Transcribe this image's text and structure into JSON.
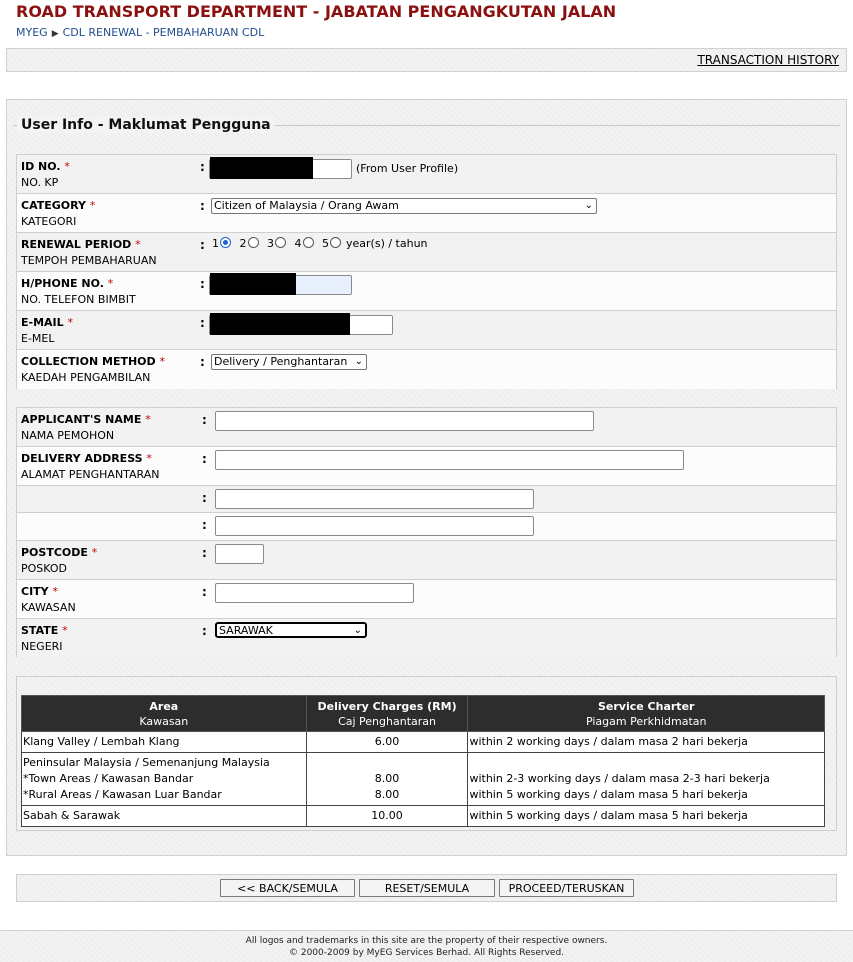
{
  "header": {
    "title": "ROAD TRANSPORT DEPARTMENT - JABATAN PENGANGKUTAN JALAN",
    "breadcrumb": [
      "MYEG",
      "CDL RENEWAL - PEMBAHARUAN CDL"
    ],
    "transaction_history": "TRANSACTION HISTORY"
  },
  "section": {
    "title": "User Info - Maklumat Pengguna"
  },
  "user_info": {
    "id_no": {
      "label": "ID NO.",
      "sub": "NO. KP",
      "required": "*",
      "note": "(From User Profile)"
    },
    "category": {
      "label": "CATEGORY",
      "sub": "KATEGORI",
      "required": "*",
      "selected": "Citizen of Malaysia / Orang Awam"
    },
    "renewal_period": {
      "label": "RENEWAL PERIOD",
      "sub": "TEMPOH PEMBAHARUAN",
      "required": "*",
      "options": [
        "1",
        "2",
        "3",
        "4",
        "5"
      ],
      "selected": "1",
      "suffix": "year(s) / tahun"
    },
    "phone": {
      "label": "H/PHONE NO.",
      "sub": "NO. TELEFON BIMBIT",
      "required": "*"
    },
    "email": {
      "label": "E-MAIL",
      "sub": "E-MEL",
      "required": "*"
    },
    "collection": {
      "label": "COLLECTION METHOD",
      "sub": "KAEDAH PENGAMBILAN",
      "required": "*",
      "selected": "Delivery / Penghantaran"
    }
  },
  "delivery": {
    "name": {
      "label": "APPLICANT'S NAME",
      "sub": "NAMA PEMOHON",
      "required": "*",
      "value": ""
    },
    "address": {
      "label": "DELIVERY ADDRESS",
      "sub": "ALAMAT PENGHANTARAN",
      "required": "*",
      "line1": "",
      "line2": "",
      "line3": ""
    },
    "postcode": {
      "label": "POSTCODE",
      "sub": "POSKOD",
      "required": "*",
      "value": ""
    },
    "city": {
      "label": "CITY",
      "sub": "KAWASAN",
      "required": "*",
      "value": ""
    },
    "state": {
      "label": "STATE",
      "sub": "NEGERI",
      "required": "*",
      "selected": "SARAWAK"
    }
  },
  "charges": {
    "headers": [
      {
        "en": "Area",
        "ms": "Kawasan"
      },
      {
        "en": "Delivery Charges (RM)",
        "ms": "Caj Penghantaran"
      },
      {
        "en": "Service Charter",
        "ms": "Piagam Perkhidmatan"
      }
    ],
    "rows": [
      {
        "area": "Klang Valley / Lembah Klang",
        "charge": "6.00",
        "charter": "within 2 working days / dalam masa 2 hari bekerja"
      },
      {
        "area": "Peninsular Malaysia / Semenanjung Malaysia",
        "charge": "",
        "charter": ""
      },
      {
        "area": "*Town Areas / Kawasan Bandar",
        "charge": "8.00",
        "charter": "within 2-3 working days / dalam masa 2-3 hari bekerja"
      },
      {
        "area": "*Rural Areas / Kawasan Luar Bandar",
        "charge": "8.00",
        "charter": "within 5 working days / dalam masa 5 hari bekerja"
      },
      {
        "area": "Sabah & Sarawak",
        "charge": "10.00",
        "charter": "within 5 working days / dalam masa 5 hari bekerja"
      }
    ]
  },
  "buttons": {
    "back": "<< BACK/SEMULA",
    "reset": "RESET/SEMULA",
    "proceed": "PROCEED/TERUSKAN"
  },
  "footer": {
    "line1": "All logos and trademarks in this site are the property of their respective owners.",
    "line2": "© 2000-2009 by MyEG Services Berhad. All Rights Reserved."
  }
}
